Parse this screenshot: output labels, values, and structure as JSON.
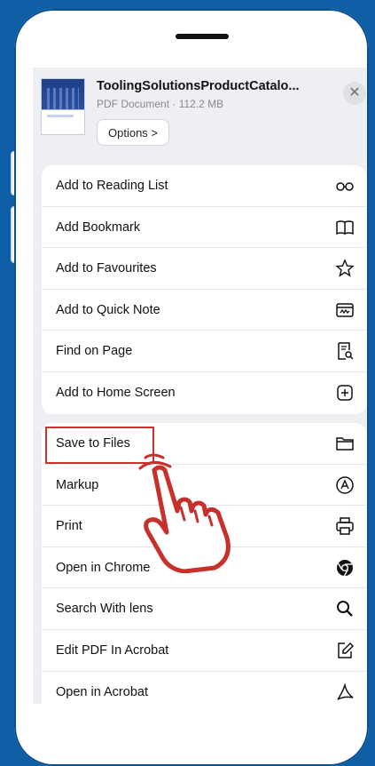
{
  "doc": {
    "title": "ToolingSolutionsProductCatalo...",
    "subtitle": "PDF Document · 112.2 MB",
    "options_label": "Options >",
    "close_label": "✕"
  },
  "groups": [
    {
      "items": [
        {
          "label": "Add to Reading List",
          "icon": "glasses-icon"
        },
        {
          "label": "Add Bookmark",
          "icon": "book-icon"
        },
        {
          "label": "Add to Favourites",
          "icon": "star-icon"
        },
        {
          "label": "Add to Quick Note",
          "icon": "quick-note-icon"
        },
        {
          "label": "Find on Page",
          "icon": "find-on-page-icon"
        },
        {
          "label": "Add to Home Screen",
          "icon": "add-square-icon"
        }
      ]
    },
    {
      "items": [
        {
          "label": "Save to Files",
          "icon": "folder-icon"
        },
        {
          "label": "Markup",
          "icon": "markup-icon"
        },
        {
          "label": "Print",
          "icon": "printer-icon"
        },
        {
          "label": "Open in Chrome",
          "icon": "chrome-icon"
        },
        {
          "label": "Search With lens",
          "icon": "magnifier-icon"
        },
        {
          "label": "Edit PDF In Acrobat",
          "icon": "edit-icon"
        },
        {
          "label": "Open in Acrobat",
          "icon": "acrobat-icon"
        }
      ]
    }
  ],
  "colors": {
    "background": "#0f5fa6",
    "highlight": "#d0312d"
  }
}
